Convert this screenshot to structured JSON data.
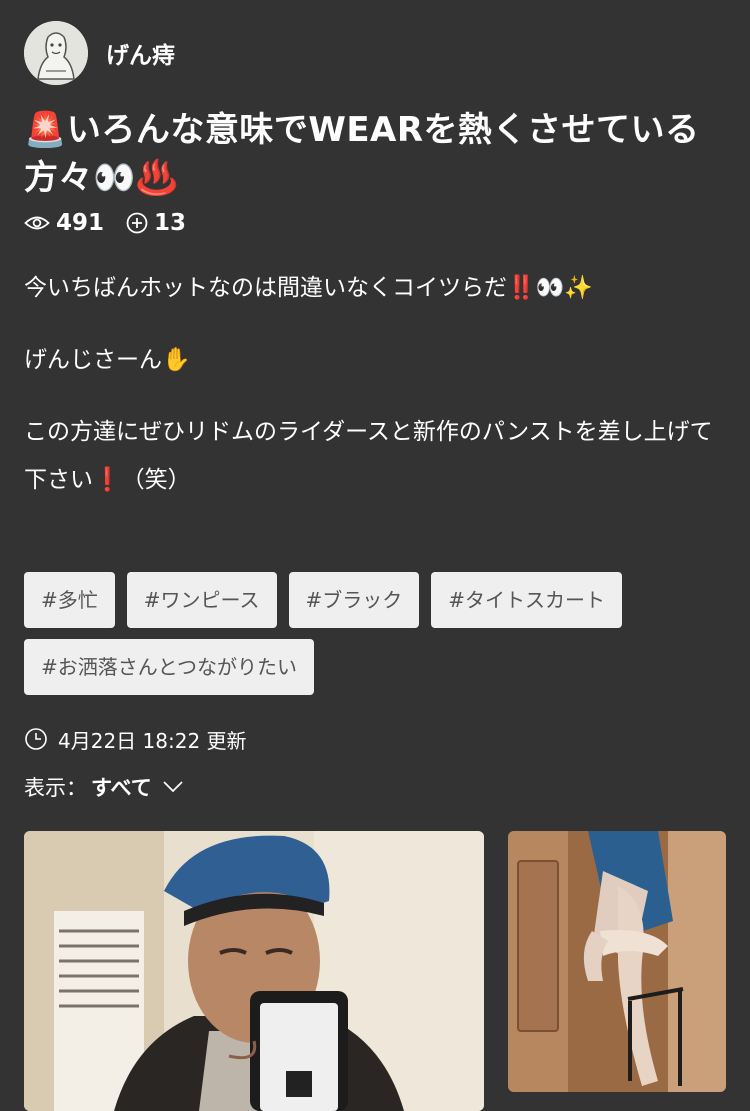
{
  "user": {
    "name": "げん痔"
  },
  "post": {
    "title": "🚨いろんな意味でWEARを熱くさせている方々👀♨️",
    "views": "491",
    "saves": "13",
    "description": [
      "今いちばんホットなのは間違いなくコイツらだ‼️👀✨",
      "げんじさーん✋",
      "この方達にぜひリドムのライダースと新作のパンストを差し上げて下さい❗️（笑）"
    ],
    "tags": [
      "#多忙",
      "#ワンピース",
      "#ブラック",
      "#タイトスカート",
      "#お洒落さんとつながりたい"
    ],
    "updated": "4月22日 18:22 更新"
  },
  "filter": {
    "label": "表示：",
    "value": "すべて"
  },
  "icons": {
    "views": "eye-icon",
    "saves": "plus-circle-icon",
    "updated": "clock-icon",
    "dropdown": "chevron-down-icon"
  },
  "colors": {
    "background": "#333333",
    "text": "#ffffff",
    "tag_bg": "#efefef",
    "tag_text": "#555555"
  }
}
